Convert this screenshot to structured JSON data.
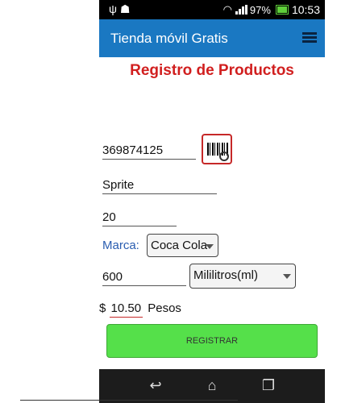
{
  "status": {
    "battery": "97%",
    "time": "10:53"
  },
  "appbar": {
    "title": "Tienda móvil Gratis"
  },
  "form": {
    "title": "Registro de Productos",
    "barcode_value": "369874125",
    "product_name": "Sprite",
    "quantity": "20",
    "brand_label": "Marca:",
    "brand_selected": "Coca Cola",
    "volume": "600",
    "unit_selected": "Mililitros(ml)",
    "currency_symbol": "$",
    "price": "10.50",
    "currency_name": "Pesos",
    "submit_label": "REGISTRAR"
  },
  "colors": {
    "appbar": "#1a78c2",
    "title": "#d11f1f",
    "button": "#55e04a"
  }
}
